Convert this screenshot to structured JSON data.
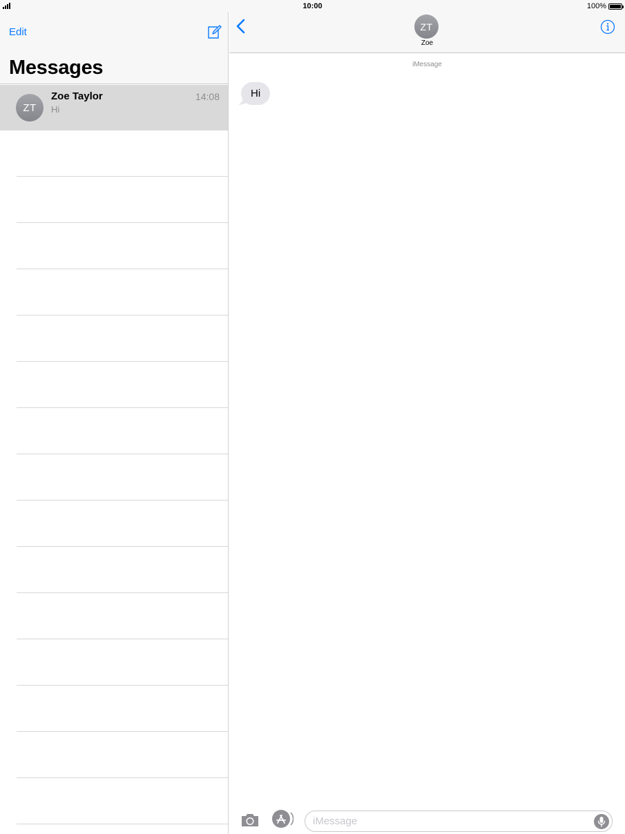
{
  "status_bar": {
    "time": "10:00",
    "battery_percent": "100%",
    "icons": [
      "signal-icon",
      "battery-icon"
    ]
  },
  "sidebar": {
    "edit_label": "Edit",
    "title": "Messages",
    "compose_icon": "compose-icon",
    "conversations": [
      {
        "initials": "ZT",
        "name": "Zoe Taylor",
        "preview": "Hi",
        "time": "14:08",
        "selected": true
      }
    ]
  },
  "chat": {
    "contact": {
      "initials": "ZT",
      "name": "Zoe"
    },
    "back_icon": "chevron-left-icon",
    "info_icon": "info-icon",
    "service_label": "iMessage",
    "messages": [
      {
        "text": "Hi",
        "direction": "incoming"
      }
    ],
    "input": {
      "placeholder": "iMessage",
      "value": ""
    },
    "toolbar_icons": [
      "camera-icon",
      "app-store-icon",
      "microphone-icon"
    ]
  },
  "colors": {
    "accent": "#0a7aff",
    "selected_row": "#d9d9d9",
    "bubble_incoming": "#e5e5ea",
    "header_bg": "#f7f7f7",
    "secondary_text": "#8e8e93"
  }
}
